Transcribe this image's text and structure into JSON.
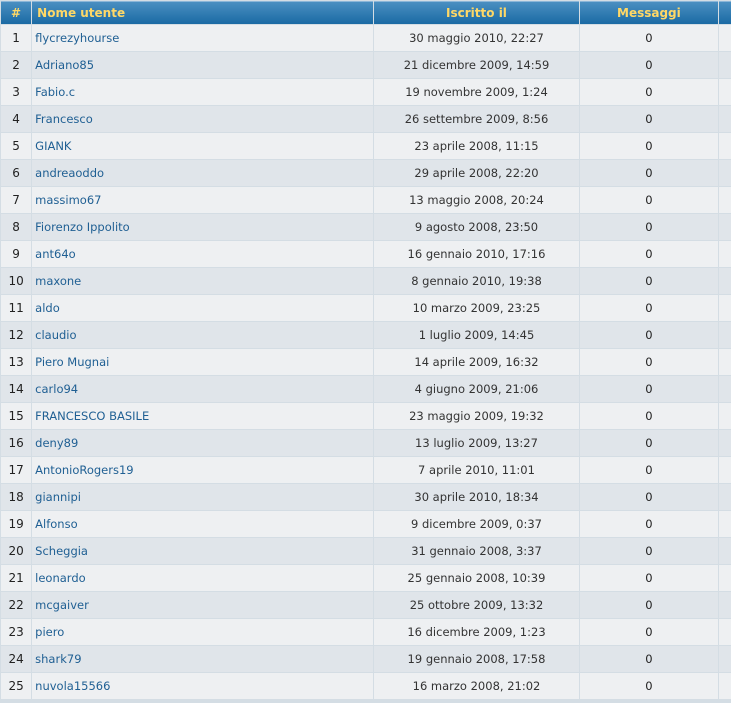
{
  "header": {
    "num": "#",
    "name": "Nome utente",
    "joined": "Iscritto il",
    "posts": "Messaggi"
  },
  "members": [
    {
      "num": "1",
      "name": "flycrezyhourse",
      "joined": "30 maggio 2010, 22:27",
      "posts": "0"
    },
    {
      "num": "2",
      "name": "Adriano85",
      "joined": "21 dicembre 2009, 14:59",
      "posts": "0"
    },
    {
      "num": "3",
      "name": "Fabio.c",
      "joined": "19 novembre 2009, 1:24",
      "posts": "0"
    },
    {
      "num": "4",
      "name": "Francesco",
      "joined": "26 settembre 2009, 8:56",
      "posts": "0"
    },
    {
      "num": "5",
      "name": "GIANK",
      "joined": "23 aprile 2008, 11:15",
      "posts": "0"
    },
    {
      "num": "6",
      "name": "andreaoddo",
      "joined": "29 aprile 2008, 22:20",
      "posts": "0"
    },
    {
      "num": "7",
      "name": "massimo67",
      "joined": "13 maggio 2008, 20:24",
      "posts": "0"
    },
    {
      "num": "8",
      "name": "Fiorenzo Ippolito",
      "joined": "9 agosto 2008, 23:50",
      "posts": "0"
    },
    {
      "num": "9",
      "name": "ant64o",
      "joined": "16 gennaio 2010, 17:16",
      "posts": "0"
    },
    {
      "num": "10",
      "name": "maxone",
      "joined": "8 gennaio 2010, 19:38",
      "posts": "0"
    },
    {
      "num": "11",
      "name": "aldo",
      "joined": "10 marzo 2009, 23:25",
      "posts": "0"
    },
    {
      "num": "12",
      "name": "claudio",
      "joined": "1 luglio 2009, 14:45",
      "posts": "0"
    },
    {
      "num": "13",
      "name": "Piero Mugnai",
      "joined": "14 aprile 2009, 16:32",
      "posts": "0"
    },
    {
      "num": "14",
      "name": "carlo94",
      "joined": "4 giugno 2009, 21:06",
      "posts": "0"
    },
    {
      "num": "15",
      "name": "FRANCESCO BASILE",
      "joined": "23 maggio 2009, 19:32",
      "posts": "0"
    },
    {
      "num": "16",
      "name": "deny89",
      "joined": "13 luglio 2009, 13:27",
      "posts": "0"
    },
    {
      "num": "17",
      "name": "AntonioRogers19",
      "joined": "7 aprile 2010, 11:01",
      "posts": "0"
    },
    {
      "num": "18",
      "name": "giannipi",
      "joined": "30 aprile 2010, 18:34",
      "posts": "0"
    },
    {
      "num": "19",
      "name": "Alfonso",
      "joined": "9 dicembre 2009, 0:37",
      "posts": "0"
    },
    {
      "num": "20",
      "name": "Scheggia",
      "joined": "31 gennaio 2008, 3:37",
      "posts": "0"
    },
    {
      "num": "21",
      "name": "leonardo",
      "joined": "25 gennaio 2008, 10:39",
      "posts": "0"
    },
    {
      "num": "22",
      "name": "mcgaiver",
      "joined": "25 ottobre 2009, 13:32",
      "posts": "0"
    },
    {
      "num": "23",
      "name": "piero",
      "joined": "16 dicembre 2009, 1:23",
      "posts": "0"
    },
    {
      "num": "24",
      "name": "shark79",
      "joined": "19 gennaio 2008, 17:58",
      "posts": "0"
    },
    {
      "num": "25",
      "name": "nuvola15566",
      "joined": "16 marzo 2008, 21:02",
      "posts": "0"
    }
  ]
}
